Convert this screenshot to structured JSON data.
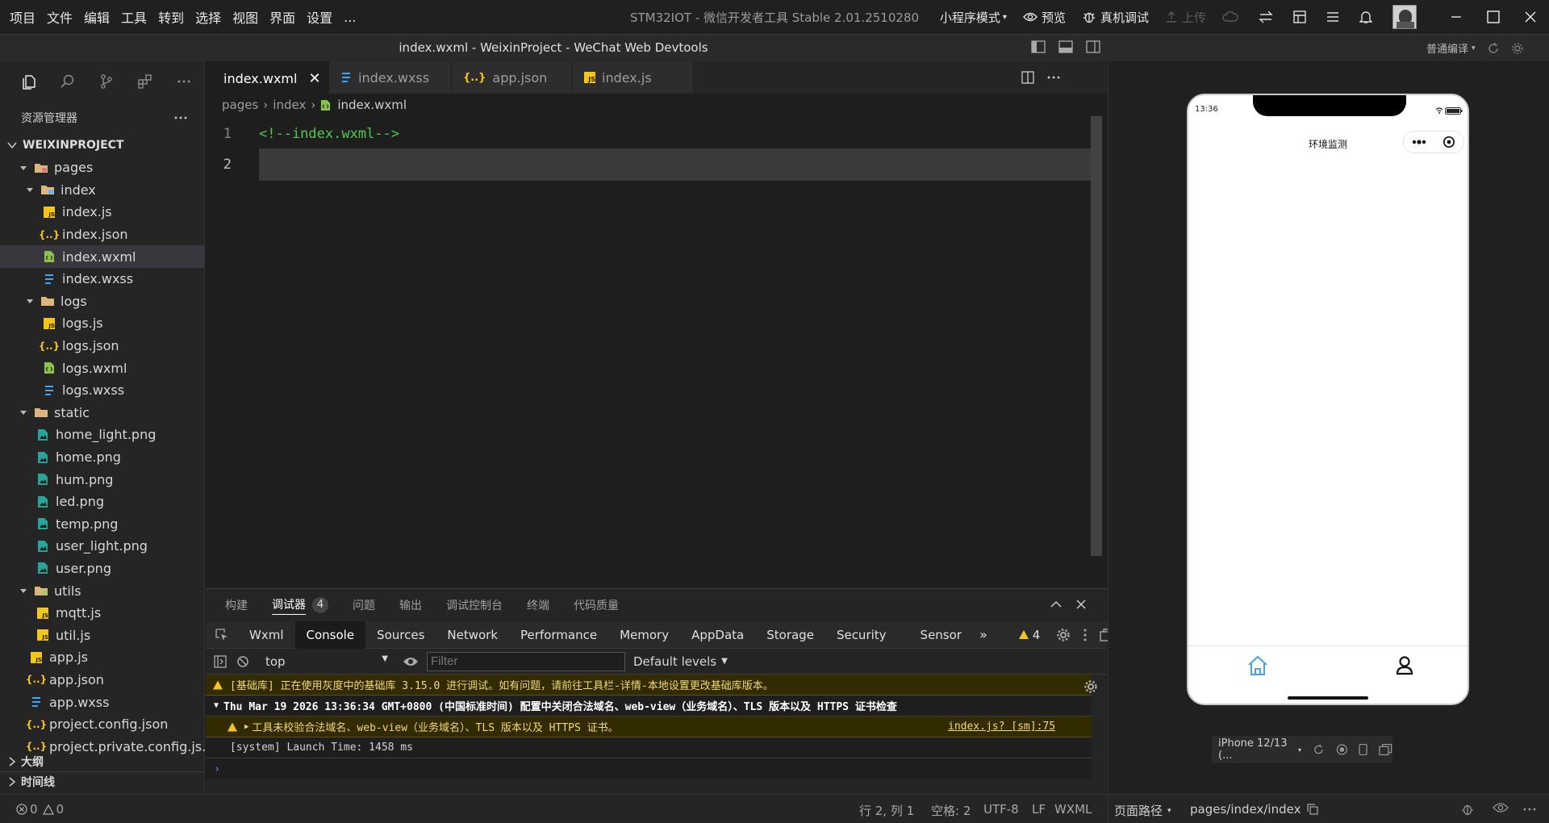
{
  "menubar": {
    "items": [
      "项目",
      "文件",
      "编辑",
      "工具",
      "转到",
      "选择",
      "视图",
      "界面",
      "设置",
      "..."
    ],
    "title": "STM32IOT - 微信开发者工具 Stable 2.01.2510280",
    "mode": "小程序模式",
    "preview": "预览",
    "debug": "真机调试",
    "upload": "上传"
  },
  "bar2": {
    "title": "index.wxml - WeixinProject - WeChat Web Devtools",
    "compile": "普通编译"
  },
  "sidebar": {
    "explorer_label": "资源管理器",
    "project": "WEIXINPROJECT",
    "tree": [
      {
        "label": "pages",
        "type": "folder-red",
        "depth": 0,
        "open": true
      },
      {
        "label": "index",
        "type": "folder-blue",
        "depth": 1,
        "open": true
      },
      {
        "label": "index.js",
        "type": "js",
        "depth": 2
      },
      {
        "label": "index.json",
        "type": "json",
        "depth": 2
      },
      {
        "label": "index.wxml",
        "type": "wxml",
        "depth": 2,
        "active": true
      },
      {
        "label": "index.wxss",
        "type": "wxss",
        "depth": 2
      },
      {
        "label": "logs",
        "type": "folder",
        "depth": 1,
        "open": true
      },
      {
        "label": "logs.js",
        "type": "js",
        "depth": 2
      },
      {
        "label": "logs.json",
        "type": "json",
        "depth": 2
      },
      {
        "label": "logs.wxml",
        "type": "wxml",
        "depth": 2
      },
      {
        "label": "logs.wxss",
        "type": "wxss",
        "depth": 2
      },
      {
        "label": "static",
        "type": "folder",
        "depth": 0,
        "open": true
      },
      {
        "label": "home_light.png",
        "type": "png",
        "depth": 1
      },
      {
        "label": "home.png",
        "type": "png",
        "depth": 1
      },
      {
        "label": "hum.png",
        "type": "png",
        "depth": 1
      },
      {
        "label": "led.png",
        "type": "png",
        "depth": 1
      },
      {
        "label": "temp.png",
        "type": "png",
        "depth": 1
      },
      {
        "label": "user_light.png",
        "type": "png",
        "depth": 1
      },
      {
        "label": "user.png",
        "type": "png",
        "depth": 1
      },
      {
        "label": "utils",
        "type": "folder-green",
        "depth": 0,
        "open": true
      },
      {
        "label": "mqtt.js",
        "type": "js",
        "depth": 1
      },
      {
        "label": "util.js",
        "type": "js",
        "depth": 1
      },
      {
        "label": "app.js",
        "type": "js",
        "depth": 0
      },
      {
        "label": "app.json",
        "type": "json",
        "depth": 0
      },
      {
        "label": "app.wxss",
        "type": "wxss",
        "depth": 0
      },
      {
        "label": "project.config.json",
        "type": "json",
        "depth": 0
      },
      {
        "label": "project.private.config.js...",
        "type": "json",
        "depth": 0
      }
    ],
    "outline": "大纲",
    "timeline": "时间线"
  },
  "tabs": [
    {
      "label": "index.wxml",
      "icon": "wxml",
      "active": true
    },
    {
      "label": "index.wxss",
      "icon": "wxss"
    },
    {
      "label": "app.json",
      "icon": "json"
    },
    {
      "label": "index.js",
      "icon": "js"
    }
  ],
  "breadcrumb": [
    "pages",
    "index",
    "index.wxml"
  ],
  "code": [
    {
      "n": "1",
      "text": "<!--index.wxml-->"
    },
    {
      "n": "2",
      "text": ""
    }
  ],
  "panel": {
    "tabs": [
      "构建",
      "调试器",
      "问题",
      "输出",
      "调试控制台",
      "终端",
      "代码质量"
    ],
    "badge": "4",
    "devtabs": [
      "Wxml",
      "Console",
      "Sources",
      "Network",
      "Performance",
      "Memory",
      "AppData",
      "Storage",
      "Security",
      "Sensor"
    ],
    "warn_count": "4",
    "context": "top",
    "filter_placeholder": "Filter",
    "levels": "Default levels",
    "messages": [
      "[基础库] 正在使用灰度中的基础库 3.15.0 进行调试。如有问题，请前往工具栏-详情-本地设置更改基础库版本。",
      "Thu Mar 19 2026 13:36:34 GMT+0800 (中国标准时间) 配置中关闭合法域名、web-view（业务域名）、TLS 版本以及 HTTPS 证书检查",
      "工具未校验合法域名、web-view（业务域名）、TLS 版本以及 HTTPS 证书。",
      "[system] Launch Time: 1458 ms"
    ],
    "source_link": "index.js? [sm]:75"
  },
  "status": {
    "errors": "0",
    "warnings": "0",
    "position": "行 2, 列 1",
    "spaces": "空格: 2",
    "encoding": "UTF-8",
    "eol": "LF",
    "lang": "WXML",
    "page_path_label": "页面路径",
    "page_path": "pages/index/index"
  },
  "phone": {
    "time": "13:36",
    "nav_title": "环境监测",
    "device": "iPhone 12/13 (..."
  },
  "colors": {
    "accent": "#1aad19",
    "tabbar_active": "#4aa3df"
  }
}
